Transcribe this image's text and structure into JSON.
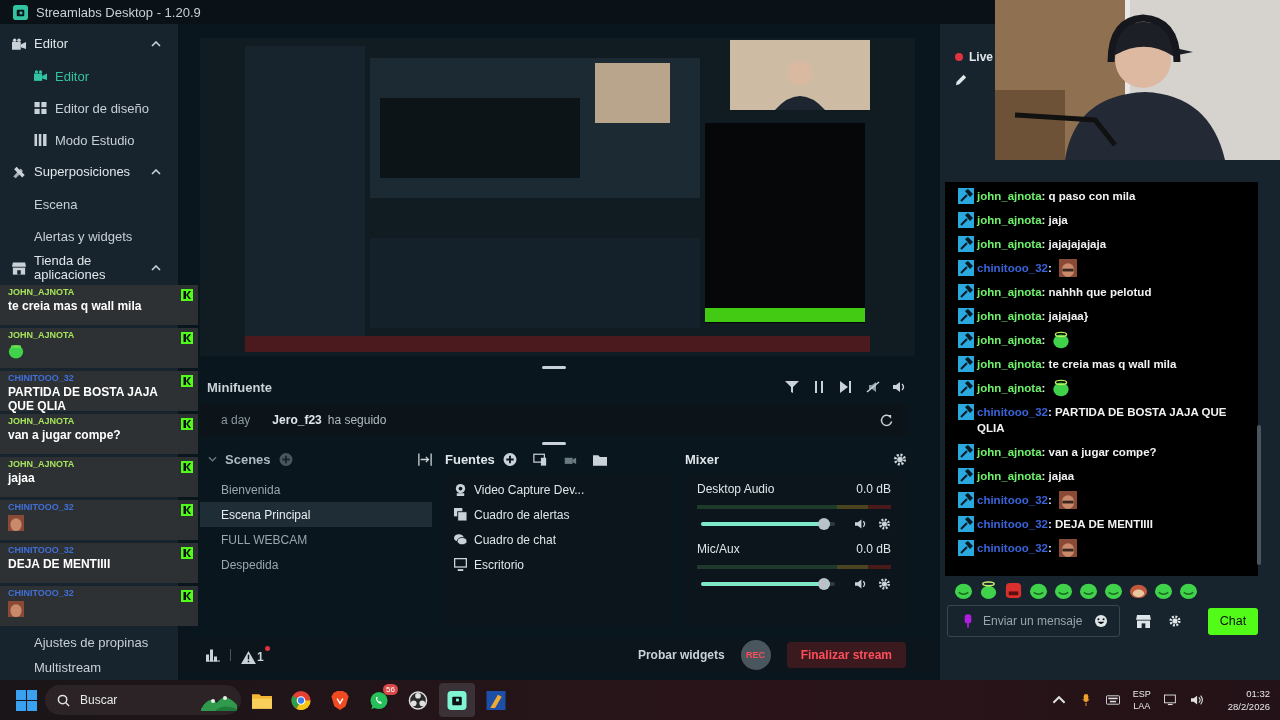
{
  "window": {
    "title": "Streamlabs Desktop - 1.20.9"
  },
  "sidebar": {
    "groups": [
      {
        "label": "Editor",
        "expanded": true,
        "items": [
          {
            "label": "Editor",
            "selected": true
          },
          {
            "label": "Editor de diseño",
            "selected": false
          },
          {
            "label": "Modo Estudio",
            "selected": false
          }
        ]
      },
      {
        "label": "Superposiciones",
        "expanded": true,
        "items": [
          {
            "label": "Escena",
            "selected": false
          },
          {
            "label": "Alertas y widgets",
            "selected": false
          }
        ]
      },
      {
        "label": "Tienda de aplicaciones",
        "expanded": true
      }
    ],
    "more_items": [
      "Ajustes de propinas",
      "Multistream"
    ]
  },
  "overlay_chat": [
    {
      "user": "JOHN_AJNOTA",
      "color": "#a6e35c",
      "kind": "text",
      "text": "te creia mas q wall mila"
    },
    {
      "user": "JOHN_AJNOTA",
      "color": "#a6e35c",
      "kind": "blob"
    },
    {
      "user": "CHINITOOO_32",
      "color": "#3f6fd8",
      "kind": "text",
      "text": "PARTIDA DE BOSTA JAJA QUE QLIA"
    },
    {
      "user": "JOHN_AJNOTA",
      "color": "#a6e35c",
      "kind": "text",
      "text": "van a jugar compe?"
    },
    {
      "user": "JOHN_AJNOTA",
      "color": "#a6e35c",
      "kind": "text",
      "text": "jajaa"
    },
    {
      "user": "CHINITOOO_32",
      "color": "#3f6fd8"
    },
    {
      "user": "CHINITOOO_32",
      "color": "#3f6fd8",
      "kind": "text",
      "text": "DEJA DE MENTIIII"
    },
    {
      "user": "CHINITOOO_32",
      "color": "#3f6fd8"
    }
  ],
  "minifuente": {
    "title": "Minifuente",
    "event": {
      "time": "a day",
      "user": "Jero_f23",
      "action": "ha seguido"
    }
  },
  "scenes": {
    "title": "Scenes",
    "items": [
      {
        "label": "Bienvenida",
        "selected": false
      },
      {
        "label": "Escena Principal",
        "selected": true
      },
      {
        "label": "FULL WEBCAM",
        "selected": false
      },
      {
        "label": "Despedida",
        "selected": false
      }
    ]
  },
  "sources": {
    "title": "Fuentes",
    "items": [
      "Video Capture Dev...",
      "Cuadro de alertas",
      "Cuadro de chat",
      "Escritorio"
    ]
  },
  "mixer": {
    "title": "Mixer",
    "channels": [
      {
        "name": "Desktop Audio",
        "reading": "0.0 dB",
        "level": 0.96
      },
      {
        "name": "Mic/Aux",
        "reading": "0.0 dB",
        "level": 0.96
      }
    ]
  },
  "footer": {
    "alert_count": "1",
    "test_button": "Probar widgets",
    "rec_label": "REC",
    "end_button": "Finalizar stream"
  },
  "chat": {
    "status": "Live",
    "messages": [
      {
        "user": "john_ajnota",
        "color": "#6ef36a",
        "kind": "text",
        "text": ": q paso con mila"
      },
      {
        "user": "john_ajnota",
        "color": "#6ef36a",
        "kind": "text",
        "text": ": jaja"
      },
      {
        "user": "john_ajnota",
        "color": "#6ef36a",
        "kind": "text",
        "text": ": jajajajajaja"
      },
      {
        "user": "chinitooo_32",
        "color": "#3a63d8",
        "text": ":"
      },
      {
        "user": "john_ajnota",
        "color": "#6ef36a",
        "kind": "text",
        "text": ": nahhh que pelotud"
      },
      {
        "user": "john_ajnota",
        "color": "#6ef36a",
        "kind": "text",
        "text": ": jajajaa}"
      },
      {
        "user": "john_ajnota",
        "color": "#6ef36a",
        "kind": "blob",
        "text": ":"
      },
      {
        "user": "john_ajnota",
        "color": "#6ef36a",
        "kind": "text",
        "text": ": te creia mas q wall mila"
      },
      {
        "user": "john_ajnota",
        "color": "#6ef36a",
        "kind": "blob",
        "text": ":"
      },
      {
        "user": "chinitooo_32",
        "color": "#3a63d8",
        "kind": "text",
        "text": ": PARTIDA DE BOSTA JAJA QUE QLIA"
      },
      {
        "user": "john_ajnota",
        "color": "#6ef36a",
        "kind": "text",
        "text": ": van a jugar compe?"
      },
      {
        "user": "john_ajnota",
        "color": "#6ef36a",
        "kind": "text",
        "text": ": jajaa"
      },
      {
        "user": "chinitooo_32",
        "color": "#3a63d8",
        "text": ":"
      },
      {
        "user": "chinitooo_32",
        "color": "#3a63d8",
        "kind": "text",
        "text": ": DEJA DE MENTIIII"
      },
      {
        "user": "chinitooo_32",
        "color": "#3a63d8",
        "text": ":"
      }
    ],
    "input": {
      "placeholder": "Enviar un mensaje"
    },
    "send_button": "Chat"
  },
  "taskbar": {
    "search": {
      "placeholder": "Buscar"
    },
    "apps": [
      {
        "selected": false
      },
      {
        "selected": false
      },
      {
        "selected": false
      },
      {
        "selected": false,
        "badge": "56"
      },
      {
        "selected": false
      },
      {
        "selected": true
      },
      {
        "selected": false
      }
    ],
    "language": "ESP",
    "region": "LAA",
    "time": "01:32",
    "date": "28/2/2026"
  }
}
